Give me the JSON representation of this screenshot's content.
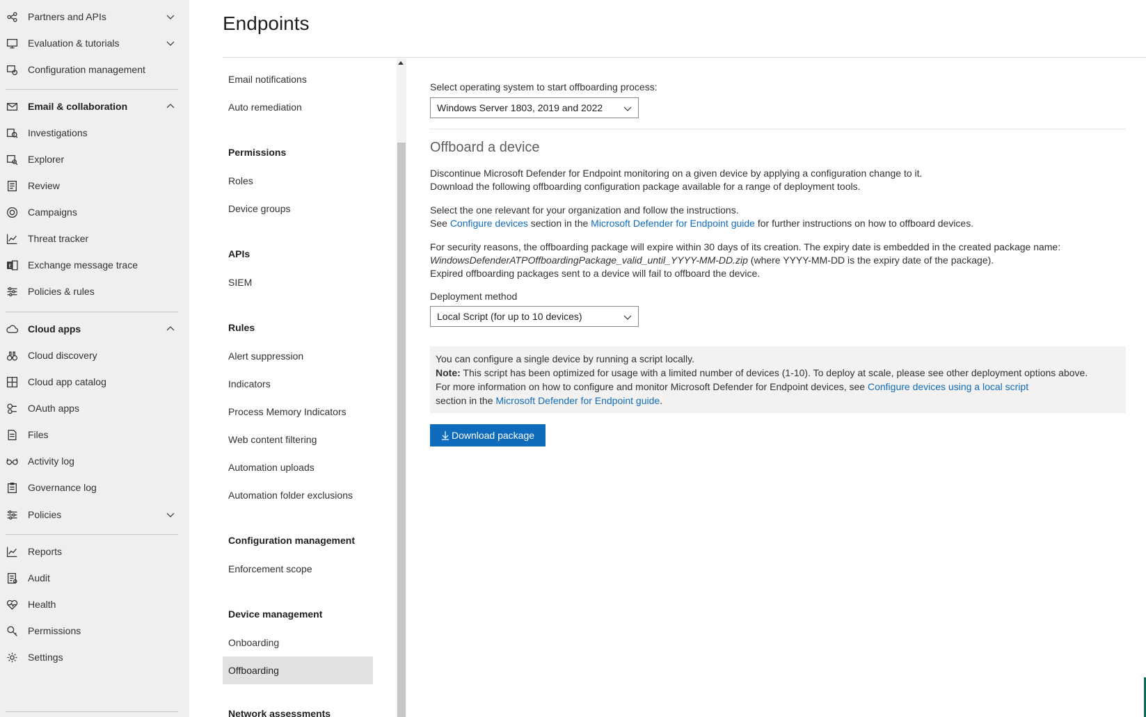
{
  "leftnav": {
    "items": [
      {
        "label": "Partners and APIs",
        "icon": "partners-icon",
        "chevron": "down"
      },
      {
        "label": "Evaluation & tutorials",
        "icon": "evaluation-icon",
        "chevron": "down"
      },
      {
        "label": "Configuration management",
        "icon": "configuration-icon"
      },
      {
        "label": "Email & collaboration",
        "icon": "mail-icon",
        "chevron": "up",
        "section": true
      },
      {
        "label": "Investigations",
        "icon": "investigations-icon"
      },
      {
        "label": "Explorer",
        "icon": "explorer-icon"
      },
      {
        "label": "Review",
        "icon": "review-icon"
      },
      {
        "label": "Campaigns",
        "icon": "campaigns-icon"
      },
      {
        "label": "Threat tracker",
        "icon": "threat-tracker-icon"
      },
      {
        "label": "Exchange message trace",
        "icon": "exchange-icon"
      },
      {
        "label": "Policies & rules",
        "icon": "policies-rules-icon"
      },
      {
        "label": "Cloud apps",
        "icon": "cloud-icon",
        "chevron": "up",
        "section": true
      },
      {
        "label": "Cloud discovery",
        "icon": "cloud-discovery-icon"
      },
      {
        "label": "Cloud app catalog",
        "icon": "app-catalog-icon"
      },
      {
        "label": "OAuth apps",
        "icon": "oauth-icon"
      },
      {
        "label": "Files",
        "icon": "files-icon"
      },
      {
        "label": "Activity log",
        "icon": "activity-log-icon"
      },
      {
        "label": "Governance log",
        "icon": "governance-log-icon"
      },
      {
        "label": "Policies",
        "icon": "policies-icon",
        "chevron": "down"
      },
      {
        "label": "Reports",
        "icon": "reports-icon"
      },
      {
        "label": "Audit",
        "icon": "audit-icon"
      },
      {
        "label": "Health",
        "icon": "health-icon"
      },
      {
        "label": "Permissions",
        "icon": "permissions-icon"
      },
      {
        "label": "Settings",
        "icon": "settings-icon"
      }
    ]
  },
  "header": {
    "title": "Endpoints"
  },
  "subnav": {
    "items": {
      "email_notifications": "Email notifications",
      "auto_remediation": "Auto remediation",
      "roles": "Roles",
      "device_groups": "Device groups",
      "siem": "SIEM",
      "alert_suppression": "Alert suppression",
      "indicators": "Indicators",
      "process_memory_indicators": "Process Memory Indicators",
      "web_content_filtering": "Web content filtering",
      "automation_uploads": "Automation uploads",
      "automation_folder_exclusions": "Automation folder exclusions",
      "enforcement_scope": "Enforcement scope",
      "onboarding": "Onboarding",
      "offboarding": "Offboarding"
    },
    "headings": {
      "permissions": "Permissions",
      "apis": "APIs",
      "rules": "Rules",
      "configuration_management": "Configuration management",
      "device_management": "Device management",
      "network_assessments": "Network assessments"
    },
    "selected": "Offboarding"
  },
  "main": {
    "os_label": "Select operating system to start offboarding process:",
    "os_value": "Windows Server 1803, 2019 and 2022",
    "section_title": "Offboard a device",
    "intro_line1": "Discontinue Microsoft Defender for Endpoint monitoring on a given device by applying a configuration change to it.",
    "intro_line2": "Download the following offboarding configuration package available for a range of deployment tools.",
    "select_line": "Select the one relevant for your organization and follow the instructions.",
    "see_prefix": "See ",
    "see_link1": "Configure devices",
    "see_middle": " section in the ",
    "see_link2": "Microsoft Defender for Endpoint guide",
    "see_suffix": " for further instructions on how to offboard devices.",
    "security_line1": "For security reasons, the offboarding package will expire within 30 days of its creation. The expiry date is embedded in the created package name:",
    "security_filename": "WindowsDefenderATPOffboardingPackage_valid_until_YYYY-MM-DD.zip",
    "security_line2_suffix": " (where YYYY-MM-DD is the expiry date of the package).",
    "security_line3": "Expired offboarding packages sent to a device will fail to offboard the device.",
    "deployment_label": "Deployment method",
    "deployment_value": "Local Script (for up to 10 devices)",
    "note": {
      "line1": "You can configure a single device by running a script locally.",
      "note_label": "Note:",
      "note_text": " This script has been optimized for usage with a limited number of devices (1-10). To deploy at scale, please see other deployment options above.",
      "line3_prefix": "For more information on how to configure and monitor Microsoft Defender for Endpoint devices, see ",
      "line3_link": "Configure devices using a local script",
      "line4_prefix": "section in the ",
      "line4_link": "Microsoft Defender for Endpoint guide",
      "line4_suffix": "."
    },
    "download_button": "Download package"
  },
  "colors": {
    "accent": "#0f6cbd",
    "nav_background": "#efefef",
    "selected_background": "#e1e1e1",
    "note_background": "#f3f2f1"
  }
}
